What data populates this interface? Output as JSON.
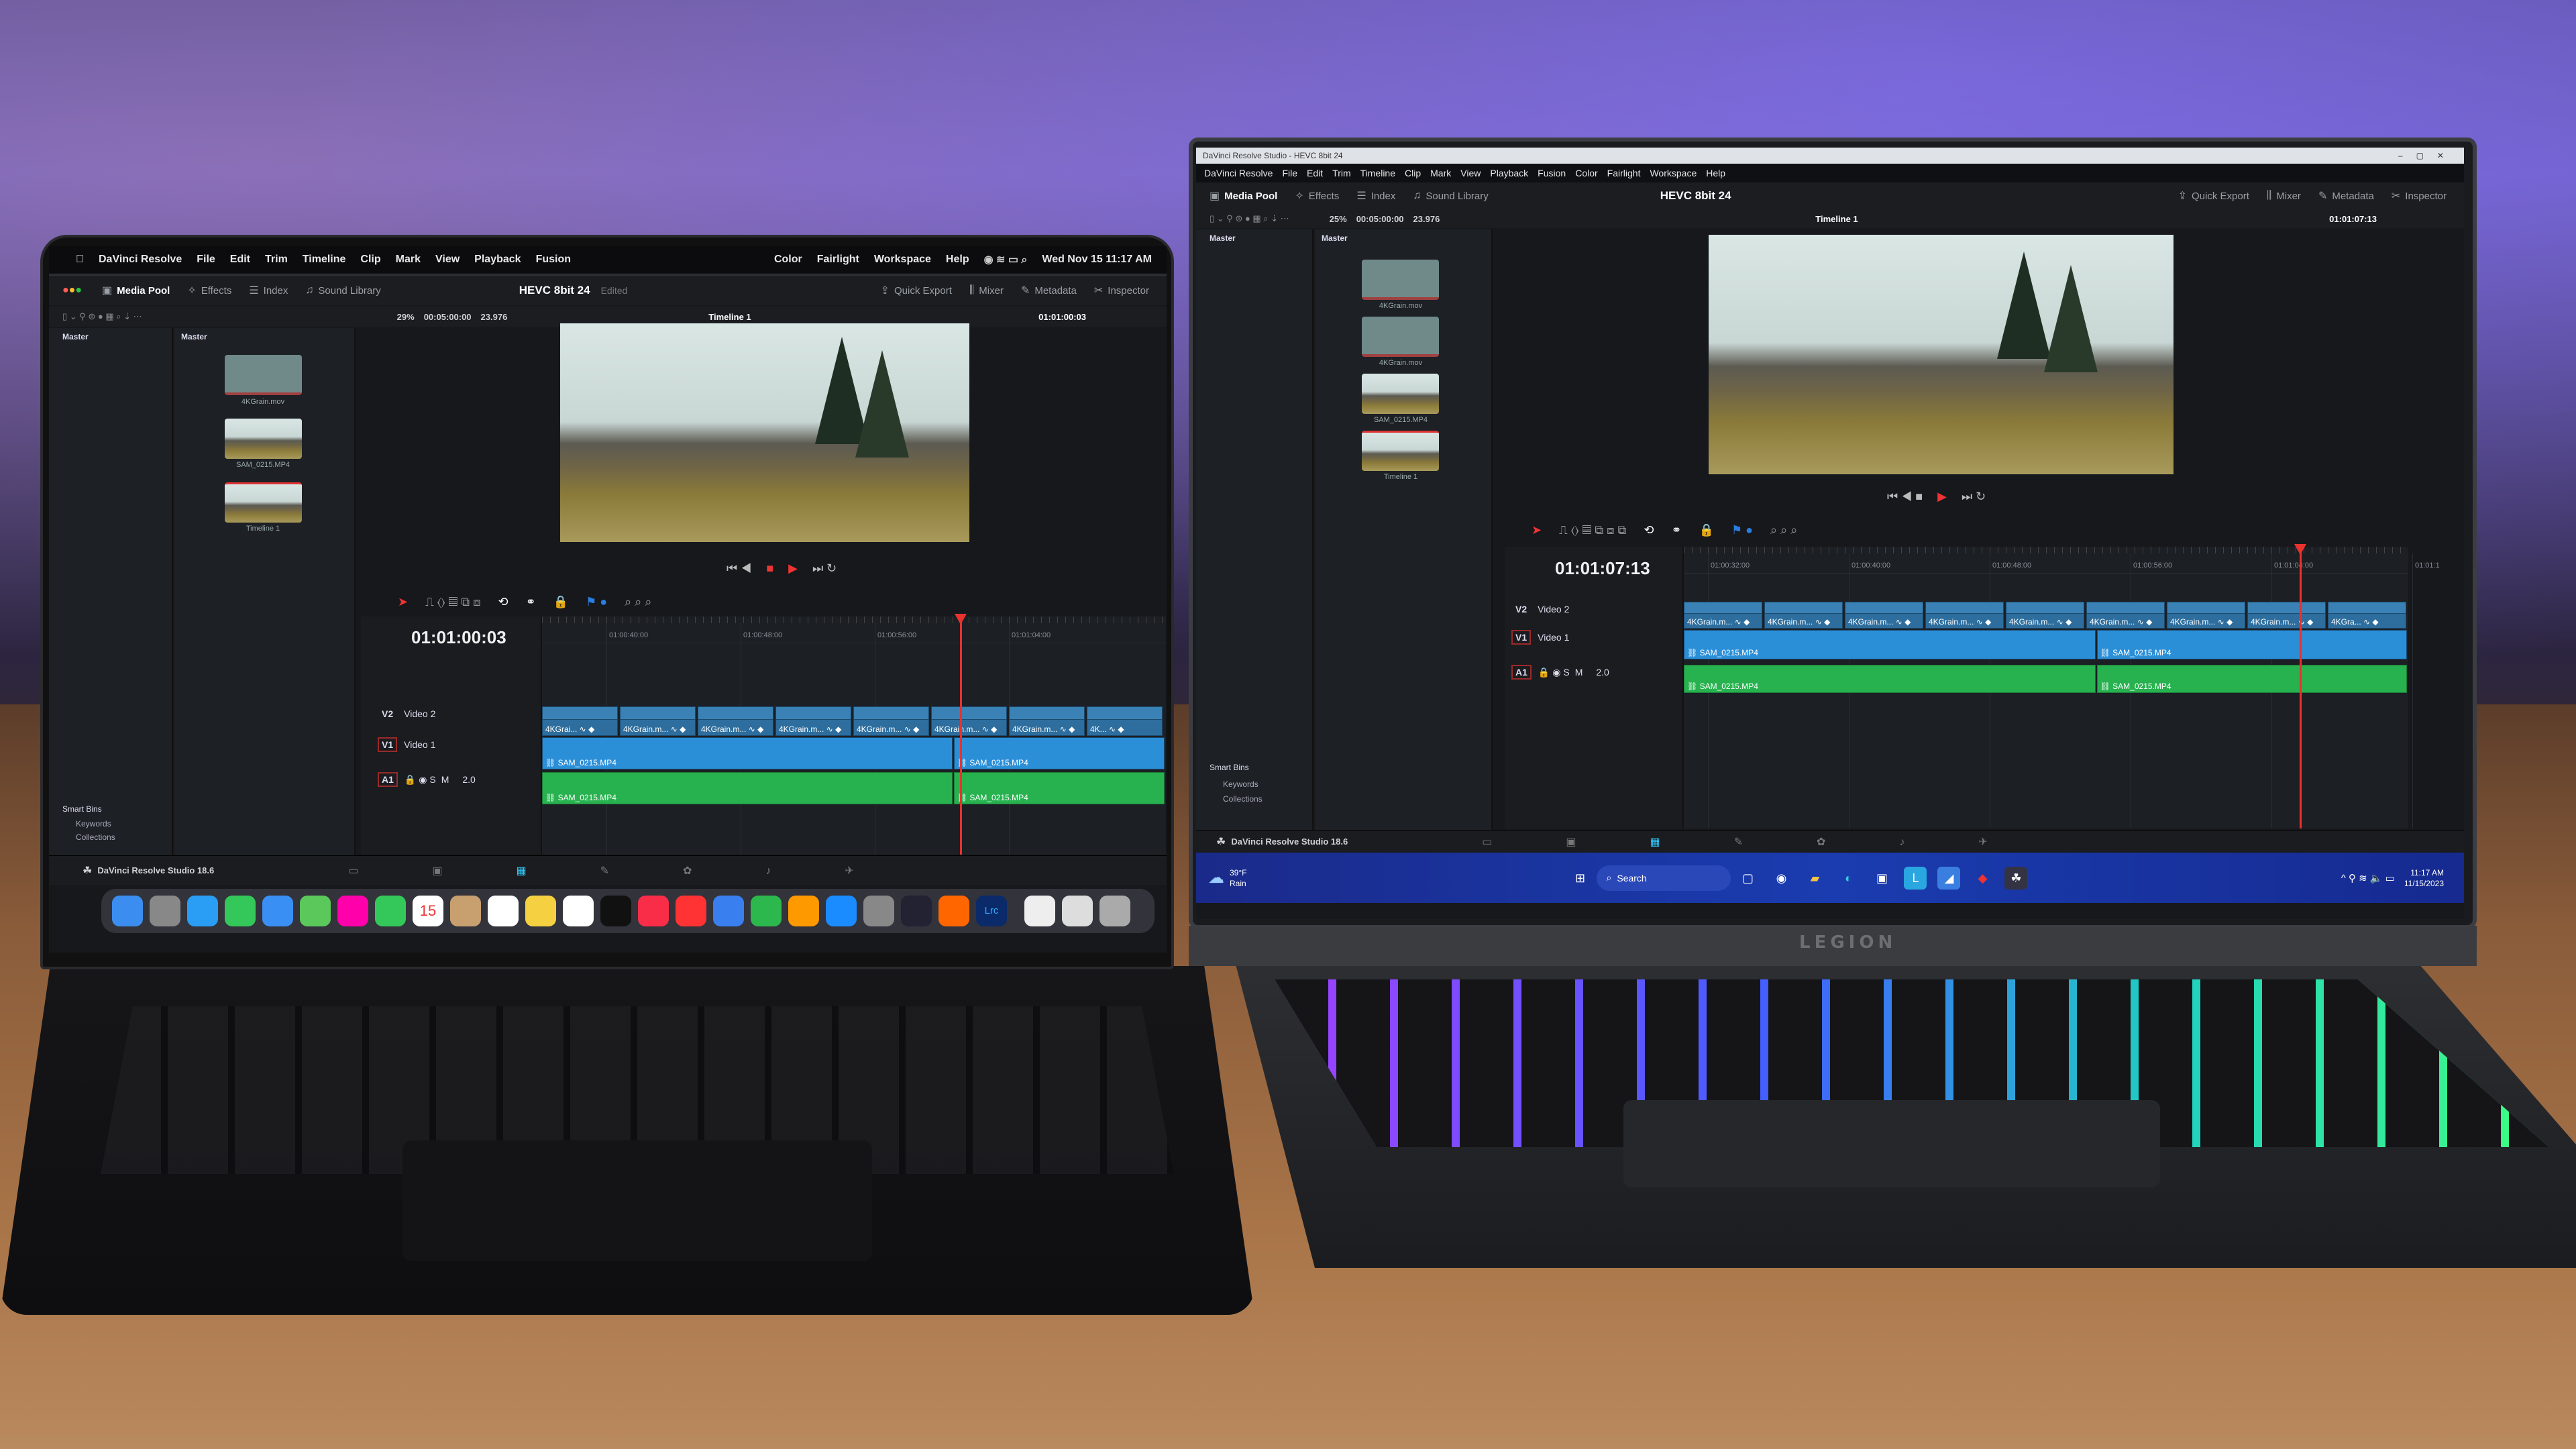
{
  "left": {
    "menubar": {
      "apple_icon": "apple-icon",
      "items": [
        "DaVinci Resolve",
        "File",
        "Edit",
        "Trim",
        "Timeline",
        "Clip",
        "Mark",
        "View",
        "Playback",
        "Fusion"
      ],
      "right_items": [
        "Color",
        "Fairlight",
        "Workspace",
        "Help"
      ],
      "clock": "Wed Nov 15  11:17 AM"
    },
    "toolbar": {
      "media_pool": "Media Pool",
      "effects": "Effects",
      "index": "Index",
      "sound_library": "Sound Library",
      "project": "HEVC 8bit 24",
      "project_status": "Edited",
      "quick_export": "Quick Export",
      "mixer": "Mixer",
      "metadata": "Metadata",
      "inspector": "Inspector"
    },
    "row2": {
      "zoom": "29%",
      "duration": "00:05:00:00",
      "fps": "23.976",
      "timeline": "Timeline 1",
      "timecode": "01:01:00:03"
    },
    "bins": {
      "master": "Master",
      "smart_bins": "Smart Bins",
      "keywords": "Keywords",
      "collections": "Collections"
    },
    "clips_header": "Master",
    "media": [
      "4KGrain.mov",
      "SAM_0215.MP4",
      "Timeline 1"
    ],
    "timeline": {
      "timecode": "01:01:00:03",
      "ruler": [
        "01:00:40:00",
        "01:00:48:00",
        "01:00:56:00",
        "01:01:04:00"
      ],
      "tracks": [
        {
          "id": "V2",
          "name": "Video 2"
        },
        {
          "id": "V1",
          "name": "Video 1"
        },
        {
          "id": "A1",
          "name": "",
          "level": "2.0"
        }
      ],
      "v2_clips": [
        "4KGrai...",
        "4KGrain.m...",
        "4KGrain.m...",
        "4KGrain.m...",
        "4KGrain.m...",
        "4KGrain.m...",
        "4KGrain.m...",
        "4K..."
      ],
      "v1_clips": [
        "SAM_0215.MP4",
        "SAM_0215.MP4"
      ],
      "a1_clips": [
        "SAM_0215.MP4",
        "SAM_0215.MP4"
      ],
      "solo": "S",
      "mute": "M"
    },
    "app_label": "DaVinci Resolve Studio 18.6",
    "dock": [
      "finder",
      "launchpad",
      "safari",
      "messages",
      "mail",
      "maps",
      "photos",
      "facetime",
      "calendar",
      "contacts",
      "reminders",
      "notes",
      "freeform",
      "tv",
      "music",
      "news",
      "keynote",
      "numbers",
      "pages",
      "app-store",
      "system-settings",
      "davinci",
      "blender",
      "lightroom",
      "preview",
      "files",
      "trash"
    ],
    "dock_calendar_day": "15",
    "dock_lrc": "Lrc"
  },
  "right": {
    "titlebar": "DaVinci Resolve Studio - HEVC 8bit 24",
    "menubar": [
      "DaVinci Resolve",
      "File",
      "Edit",
      "Trim",
      "Timeline",
      "Clip",
      "Mark",
      "View",
      "Playback",
      "Fusion",
      "Color",
      "Fairlight",
      "Workspace",
      "Help"
    ],
    "toolbar": {
      "media_pool": "Media Pool",
      "effects": "Effects",
      "index": "Index",
      "sound_library": "Sound Library",
      "project": "HEVC 8bit 24",
      "quick_export": "Quick Export",
      "mixer": "Mixer",
      "metadata": "Metadata",
      "inspector": "Inspector"
    },
    "row2": {
      "zoom": "25%",
      "duration": "00:05:00:00",
      "fps": "23.976",
      "timeline": "Timeline 1",
      "timecode": "01:01:07:13"
    },
    "bins": {
      "master": "Master",
      "smart_bins": "Smart Bins",
      "keywords": "Keywords",
      "collections": "Collections"
    },
    "clips_header": "Master",
    "media": [
      "4KGrain.mov",
      "4KGrain.mov",
      "SAM_0215.MP4",
      "Timeline 1"
    ],
    "timeline": {
      "timecode": "01:01:07:13",
      "ruler": [
        "01:00:32:00",
        "01:00:40:00",
        "01:00:48:00",
        "01:00:56:00",
        "01:01:04:00",
        "01:01:1"
      ],
      "tracks": [
        {
          "id": "V2",
          "name": "Video 2"
        },
        {
          "id": "V1",
          "name": "Video 1"
        },
        {
          "id": "A1",
          "name": "",
          "level": "2.0"
        }
      ],
      "v2_clips": [
        "4KGrain.m...",
        "4KGrain.m...",
        "4KGrain.m...",
        "4KGrain.m...",
        "4KGrain.m...",
        "4KGrain.m...",
        "4KGrain.m...",
        "4KGrain.m...",
        "4KGra..."
      ],
      "v1_clips": [
        "SAM_0215.MP4",
        "SAM_0215.MP4"
      ],
      "a1_clips": [
        "SAM_0215.MP4",
        "SAM_0215.MP4"
      ],
      "solo": "S",
      "mute": "M"
    },
    "app_label": "DaVinci Resolve Studio 18.6",
    "taskbar": {
      "weather_temp": "39°F",
      "weather_desc": "Rain",
      "search": "Search",
      "time": "11:17 AM",
      "date": "11/15/2023"
    },
    "brand": "LEGION"
  },
  "colors": {
    "clip_video": "#2b8fd8",
    "clip_v2": "#2d6e9e",
    "clip_audio": "#27b24f",
    "playhead": "#e8322e",
    "accent_red": "#9a2a2a"
  }
}
